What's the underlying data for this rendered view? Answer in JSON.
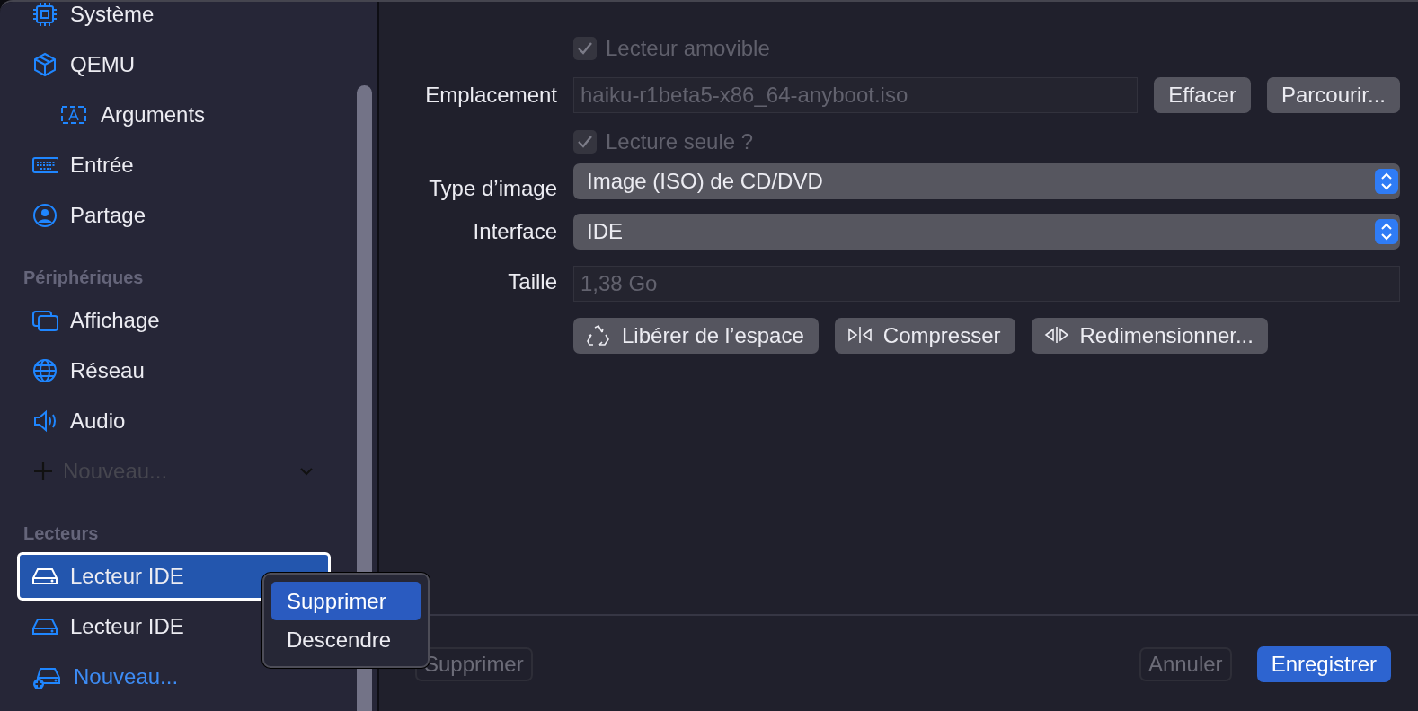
{
  "sidebar": {
    "sections": [
      {
        "items": [
          {
            "label": "Système",
            "selected": false
          },
          {
            "label": "QEMU",
            "selected": false,
            "children": [
              {
                "label": "Arguments",
                "selected": false
              }
            ]
          },
          {
            "label": "Entrée",
            "selected": false
          },
          {
            "label": "Partage",
            "selected": false
          }
        ]
      },
      {
        "title": "Périphériques",
        "items": [
          {
            "label": "Affichage",
            "selected": false
          },
          {
            "label": "Réseau",
            "selected": false
          },
          {
            "label": "Audio",
            "selected": false
          }
        ],
        "new_menu": {
          "label": "Nouveau...",
          "disabled": true
        }
      },
      {
        "title": "Lecteurs",
        "items": [
          {
            "label": "Lecteur IDE",
            "selected": true
          },
          {
            "label": "Lecteur IDE",
            "selected": false
          }
        ],
        "new_link": {
          "label": "Nouveau..."
        }
      }
    ]
  },
  "context_menu": {
    "items": [
      {
        "label": "Supprimer",
        "selected": true
      },
      {
        "label": "Descendre",
        "selected": false
      }
    ]
  },
  "form": {
    "removable": {
      "label": "Lecteur amovible",
      "checked": true,
      "disabled": true
    },
    "location": {
      "label": "Emplacement",
      "value": "haiku-r1beta5-x86_64-anyboot.iso",
      "buttons": [
        "Effacer",
        "Parcourir..."
      ]
    },
    "read_only": {
      "label": "Lecture seule ?",
      "checked": true,
      "disabled": true
    },
    "image_type": {
      "label": "Type d’image",
      "value": "Image (ISO) de CD/DVD"
    },
    "interface": {
      "label": "Interface",
      "value": "IDE"
    },
    "size": {
      "label": "Taille",
      "value": "1,38 Go"
    },
    "actions": [
      {
        "kind": "reclaim",
        "label": "Libérer de l’espace"
      },
      {
        "kind": "compress",
        "label": "Compresser"
      },
      {
        "kind": "resize",
        "label": "Redimensionner..."
      }
    ]
  },
  "footer": {
    "delete": {
      "label": "Supprimer"
    },
    "cancel": {
      "label": "Annuler"
    },
    "save": {
      "label": "Enregistrer"
    }
  }
}
